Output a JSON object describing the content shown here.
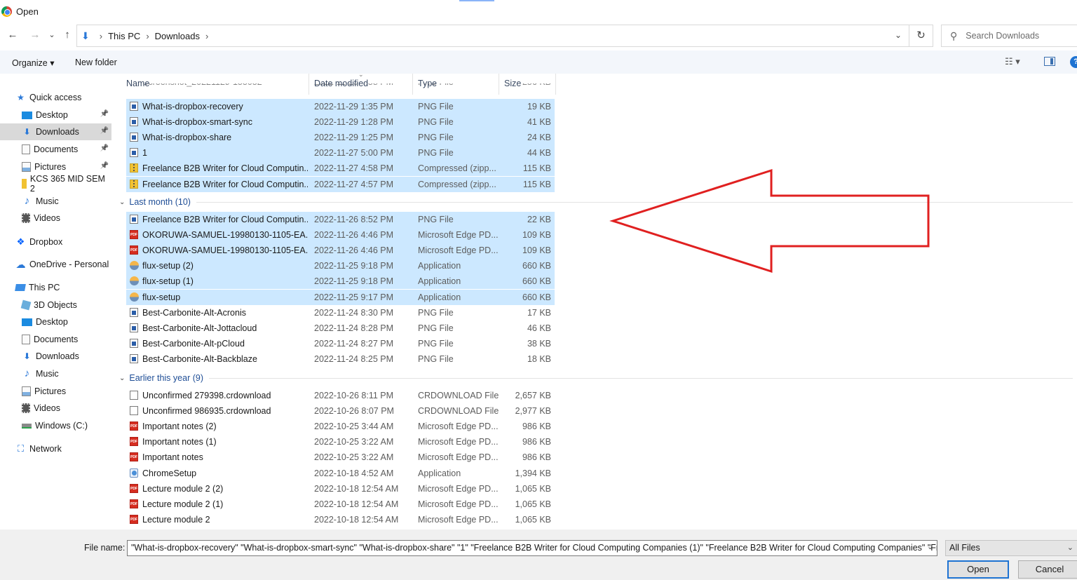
{
  "window": {
    "title": "Open"
  },
  "nav": {
    "back": "←",
    "forward": "→",
    "recent": "⌄",
    "up": "↑",
    "breadcrumb": [
      "This PC",
      "Downloads"
    ],
    "search_placeholder": "Search Downloads"
  },
  "toolbar": {
    "organize": "Organize ▾",
    "new_folder": "New folder",
    "view": "☷ ▾",
    "help": "?"
  },
  "sidebar": {
    "items": [
      {
        "label": "Quick access",
        "icon": "star-icon"
      },
      {
        "label": "Desktop",
        "icon": "desktop-icon",
        "pinned": true
      },
      {
        "label": "Downloads",
        "icon": "downloads-icon",
        "pinned": true,
        "selected": true
      },
      {
        "label": "Documents",
        "icon": "documents-icon",
        "pinned": true
      },
      {
        "label": "Pictures",
        "icon": "pictures-icon",
        "pinned": true
      },
      {
        "label": "KCS 365 MID SEM 2",
        "icon": "folder-icon"
      },
      {
        "label": "Music",
        "icon": "music-icon"
      },
      {
        "label": "Videos",
        "icon": "videos-icon"
      },
      {
        "label": "Dropbox",
        "icon": "dropbox-icon"
      },
      {
        "label": "OneDrive - Personal",
        "icon": "onedrive-icon"
      },
      {
        "label": "This PC",
        "icon": "this-pc-icon"
      },
      {
        "label": "3D Objects",
        "icon": "3d-objects-icon"
      },
      {
        "label": "Desktop",
        "icon": "desktop-icon"
      },
      {
        "label": "Documents",
        "icon": "documents-icon"
      },
      {
        "label": "Downloads",
        "icon": "downloads-icon"
      },
      {
        "label": "Music",
        "icon": "music-icon"
      },
      {
        "label": "Pictures",
        "icon": "pictures-icon"
      },
      {
        "label": "Videos",
        "icon": "videos-icon"
      },
      {
        "label": "Windows (C:)",
        "icon": "drive-icon"
      },
      {
        "label": "Network",
        "icon": "network-icon"
      }
    ]
  },
  "columns": {
    "name": "Name",
    "date": "Date modified",
    "type": "Type",
    "size": "Size"
  },
  "partial_row": {
    "name": "Screenshot_20221129-155052",
    "date": "2022-11-29 4:58 PM",
    "type": "PNG File",
    "size": "256 KB"
  },
  "groups": [
    {
      "label": "",
      "rows": [
        {
          "name": "What-is-dropbox-recovery",
          "date": "2022-11-29 1:35 PM",
          "type": "PNG File",
          "size": "19 KB",
          "icon": "png",
          "selected": true
        },
        {
          "name": "What-is-dropbox-smart-sync",
          "date": "2022-11-29 1:28 PM",
          "type": "PNG File",
          "size": "41 KB",
          "icon": "png",
          "selected": true
        },
        {
          "name": "What-is-dropbox-share",
          "date": "2022-11-29 1:25 PM",
          "type": "PNG File",
          "size": "24 KB",
          "icon": "png",
          "selected": true
        },
        {
          "name": "1",
          "date": "2022-11-27 5:00 PM",
          "type": "PNG File",
          "size": "44 KB",
          "icon": "png",
          "selected": true
        },
        {
          "name": "Freelance B2B Writer for Cloud Computin...",
          "date": "2022-11-27 4:58 PM",
          "type": "Compressed (zipp...",
          "size": "115 KB",
          "icon": "zip",
          "selected": true
        },
        {
          "name": "Freelance B2B Writer for Cloud Computin...",
          "date": "2022-11-27 4:57 PM",
          "type": "Compressed (zipp...",
          "size": "115 KB",
          "icon": "zip",
          "selected": true
        }
      ]
    },
    {
      "label": "Last month (10)",
      "rows": [
        {
          "name": "Freelance B2B Writer for Cloud Computin...",
          "date": "2022-11-26 8:52 PM",
          "type": "PNG File",
          "size": "22 KB",
          "icon": "png",
          "selected": true
        },
        {
          "name": "OKORUWA-SAMUEL-19980130-1105-EA...",
          "date": "2022-11-26 4:46 PM",
          "type": "Microsoft Edge PD...",
          "size": "109 KB",
          "icon": "pdf",
          "selected": true
        },
        {
          "name": "OKORUWA-SAMUEL-19980130-1105-EA...",
          "date": "2022-11-26 4:46 PM",
          "type": "Microsoft Edge PD...",
          "size": "109 KB",
          "icon": "pdf",
          "selected": true
        },
        {
          "name": "flux-setup (2)",
          "date": "2022-11-25 9:18 PM",
          "type": "Application",
          "size": "660 KB",
          "icon": "app",
          "selected": true
        },
        {
          "name": "flux-setup (1)",
          "date": "2022-11-25 9:18 PM",
          "type": "Application",
          "size": "660 KB",
          "icon": "app",
          "selected": true
        },
        {
          "name": "flux-setup",
          "date": "2022-11-25 9:17 PM",
          "type": "Application",
          "size": "660 KB",
          "icon": "app",
          "selected": true
        },
        {
          "name": "Best-Carbonite-Alt-Acronis",
          "date": "2022-11-24 8:30 PM",
          "type": "PNG File",
          "size": "17 KB",
          "icon": "png",
          "selected": false
        },
        {
          "name": "Best-Carbonite-Alt-Jottacloud",
          "date": "2022-11-24 8:28 PM",
          "type": "PNG File",
          "size": "46 KB",
          "icon": "png",
          "selected": false
        },
        {
          "name": "Best-Carbonite-Alt-pCloud",
          "date": "2022-11-24 8:27 PM",
          "type": "PNG File",
          "size": "38 KB",
          "icon": "png",
          "selected": false
        },
        {
          "name": "Best-Carbonite-Alt-Backblaze",
          "date": "2022-11-24 8:25 PM",
          "type": "PNG File",
          "size": "18 KB",
          "icon": "png",
          "selected": false
        }
      ]
    },
    {
      "label": "Earlier this year (9)",
      "rows": [
        {
          "name": "Unconfirmed 279398.crdownload",
          "date": "2022-10-26 8:11 PM",
          "type": "CRDOWNLOAD File",
          "size": "2,657 KB",
          "icon": "blank",
          "selected": false
        },
        {
          "name": "Unconfirmed 986935.crdownload",
          "date": "2022-10-26 8:07 PM",
          "type": "CRDOWNLOAD File",
          "size": "2,977 KB",
          "icon": "blank",
          "selected": false
        },
        {
          "name": "Important notes (2)",
          "date": "2022-10-25 3:44 AM",
          "type": "Microsoft Edge PD...",
          "size": "986 KB",
          "icon": "pdf",
          "selected": false
        },
        {
          "name": "Important notes (1)",
          "date": "2022-10-25 3:22 AM",
          "type": "Microsoft Edge PD...",
          "size": "986 KB",
          "icon": "pdf",
          "selected": false
        },
        {
          "name": "Important notes",
          "date": "2022-10-25 3:22 AM",
          "type": "Microsoft Edge PD...",
          "size": "986 KB",
          "icon": "pdf",
          "selected": false
        },
        {
          "name": "ChromeSetup",
          "date": "2022-10-18 4:52 AM",
          "type": "Application",
          "size": "1,394 KB",
          "icon": "setup",
          "selected": false
        },
        {
          "name": "Lecture module 2 (2)",
          "date": "2022-10-18 12:54 AM",
          "type": "Microsoft Edge PD...",
          "size": "1,065 KB",
          "icon": "pdf",
          "selected": false
        },
        {
          "name": "Lecture module 2 (1)",
          "date": "2022-10-18 12:54 AM",
          "type": "Microsoft Edge PD...",
          "size": "1,065 KB",
          "icon": "pdf",
          "selected": false
        },
        {
          "name": "Lecture module 2",
          "date": "2022-10-18 12:54 AM",
          "type": "Microsoft Edge PD...",
          "size": "1,065 KB",
          "icon": "pdf",
          "selected": false
        }
      ]
    }
  ],
  "footer": {
    "file_name_label": "File name:",
    "file_name_value": "\"What-is-dropbox-recovery\" \"What-is-dropbox-smart-sync\" \"What-is-dropbox-share\" \"1\" \"Freelance B2B Writer for Cloud Computing Companies (1)\" \"Freelance B2B Writer for Cloud Computing Companies\" \"Fr",
    "filter": "All Files",
    "open": "Open",
    "cancel": "Cancel"
  },
  "colors": {
    "selection": "#cce8ff",
    "accent": "#1e73d2",
    "annotation_arrow": "#e02020"
  }
}
